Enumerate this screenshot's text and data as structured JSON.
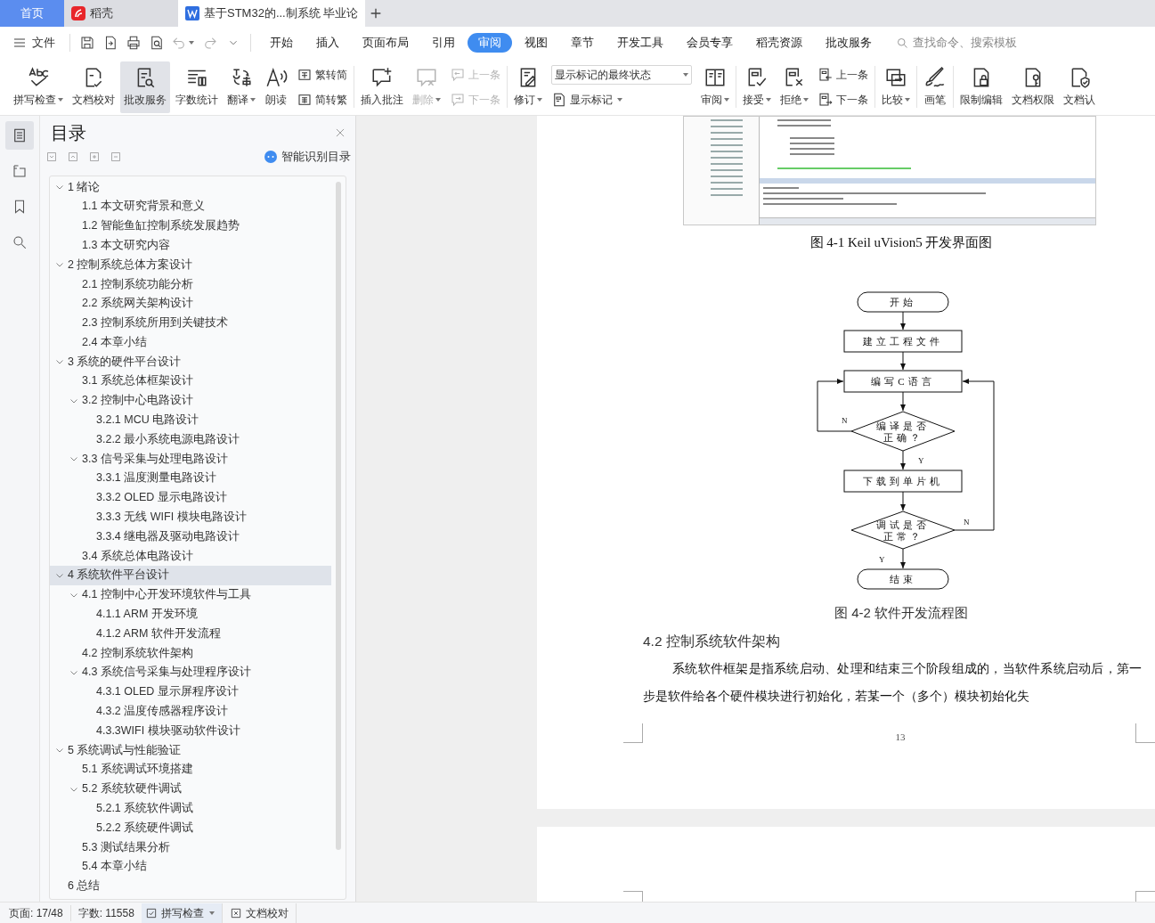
{
  "title_tabs": [
    {
      "kind": "home",
      "label": "首页",
      "selected": false
    },
    {
      "kind": "app",
      "label": "稻壳",
      "selected": false
    },
    {
      "kind": "doc",
      "label": "基于STM32的...制系统 毕业论",
      "selected": true
    }
  ],
  "menu": {
    "file": "文件",
    "tabs": [
      {
        "label": "开始",
        "selected": false
      },
      {
        "label": "插入",
        "selected": false
      },
      {
        "label": "页面布局",
        "selected": false
      },
      {
        "label": "引用",
        "selected": false
      },
      {
        "label": "审阅",
        "selected": true
      },
      {
        "label": "视图",
        "selected": false
      },
      {
        "label": "章节",
        "selected": false
      },
      {
        "label": "开发工具",
        "selected": false
      },
      {
        "label": "会员专享",
        "selected": false
      },
      {
        "label": "稻壳资源",
        "selected": false
      },
      {
        "label": "批改服务",
        "selected": false
      }
    ],
    "search": {
      "placeholder": "查找命令、搜索模板"
    }
  },
  "ribbon": {
    "groups": [
      {
        "items": [
          {
            "kind": "large",
            "label": "拼写检查",
            "caret": true,
            "disabled": false,
            "pressed": false
          },
          {
            "kind": "large",
            "label": "文档校对",
            "caret": false,
            "disabled": false,
            "pressed": false
          },
          {
            "kind": "large",
            "label": "批改服务",
            "caret": false,
            "disabled": false,
            "pressed": true
          },
          {
            "kind": "large",
            "label": "字数统计",
            "caret": false,
            "disabled": false,
            "pressed": false
          },
          {
            "kind": "large",
            "label": "翻译",
            "caret": true,
            "disabled": false,
            "pressed": false
          },
          {
            "kind": "large",
            "label": "朗读",
            "caret": false,
            "disabled": false,
            "pressed": false
          },
          {
            "kind": "stack",
            "items": [
              {
                "kind": "small",
                "label": "繁转简",
                "caret": false,
                "disabled": false
              },
              {
                "kind": "small",
                "label": "简转繁",
                "caret": false,
                "disabled": false
              }
            ]
          }
        ]
      },
      {
        "items": [
          {
            "kind": "large",
            "label": "插入批注",
            "caret": false,
            "disabled": false,
            "pressed": false
          },
          {
            "kind": "large",
            "label": "删除",
            "caret": true,
            "disabled": true,
            "pressed": false
          },
          {
            "kind": "stack",
            "items": [
              {
                "kind": "small",
                "label": "上一条",
                "caret": false,
                "disabled": true
              },
              {
                "kind": "small",
                "label": "下一条",
                "caret": false,
                "disabled": true
              }
            ]
          }
        ]
      },
      {
        "items": [
          {
            "kind": "large",
            "label": "修订",
            "caret": true,
            "disabled": false,
            "pressed": false
          },
          {
            "kind": "stack",
            "items": [
              {
                "kind": "select",
                "label": "显示标记的最终状态",
                "caret": true,
                "disabled": false
              },
              {
                "kind": "small",
                "label": "显示标记",
                "caret": true,
                "disabled": false
              }
            ]
          },
          {
            "kind": "large",
            "label": "审阅",
            "caret": true,
            "disabled": false,
            "pressed": false
          }
        ]
      },
      {
        "items": [
          {
            "kind": "large",
            "label": "接受",
            "caret": true,
            "disabled": false,
            "pressed": false
          },
          {
            "kind": "large",
            "label": "拒绝",
            "caret": true,
            "disabled": false,
            "pressed": false
          },
          {
            "kind": "stack",
            "items": [
              {
                "kind": "small",
                "label": "上一条",
                "caret": false,
                "disabled": false
              },
              {
                "kind": "small",
                "label": "下一条",
                "caret": false,
                "disabled": false
              }
            ]
          }
        ]
      },
      {
        "items": [
          {
            "kind": "large",
            "label": "比较",
            "caret": true,
            "disabled": false,
            "pressed": false
          }
        ]
      },
      {
        "items": [
          {
            "kind": "large",
            "label": "画笔",
            "caret": false,
            "disabled": false,
            "pressed": false
          }
        ]
      },
      {
        "items": [
          {
            "kind": "large",
            "label": "限制编辑",
            "caret": false,
            "disabled": false,
            "pressed": false
          },
          {
            "kind": "large",
            "label": "文档权限",
            "caret": false,
            "disabled": false,
            "pressed": false
          },
          {
            "kind": "large",
            "label": "文档认",
            "caret": false,
            "disabled": false,
            "pressed": false
          }
        ]
      }
    ]
  },
  "side_tools": [
    {
      "selected": true
    },
    {
      "selected": false
    },
    {
      "selected": false
    },
    {
      "selected": false
    }
  ],
  "toc": {
    "title": "目录",
    "smart_button": "智能识别目录",
    "items": [
      {
        "label": "1  绪论",
        "selected": false,
        "expanded": true,
        "children": [
          {
            "label": "1.1 本文研究背景和意义",
            "selected": false
          },
          {
            "label": "1.2 智能鱼缸控制系统发展趋势",
            "selected": false
          },
          {
            "label": "1.3 本文研究内容",
            "selected": false
          }
        ]
      },
      {
        "label": "2  控制系统总体方案设计",
        "selected": false,
        "expanded": true,
        "children": [
          {
            "label": "2.1 控制系统功能分析",
            "selected": false
          },
          {
            "label": "2.2 系统网关架构设计",
            "selected": false
          },
          {
            "label": "2.3 控制系统所用到关键技术",
            "selected": false
          },
          {
            "label": "2.4 本章小结",
            "selected": false
          }
        ]
      },
      {
        "label": "3  系统的硬件平台设计",
        "selected": false,
        "expanded": true,
        "children": [
          {
            "label": "3.1 系统总体框架设计",
            "selected": false
          },
          {
            "label": "3.2 控制中心电路设计",
            "selected": false,
            "expanded": true,
            "children": [
              {
                "label": "3.2.1 MCU 电路设计",
                "selected": false
              },
              {
                "label": "3.2.2 最小系统电源电路设计",
                "selected": false
              }
            ]
          },
          {
            "label": "3.3 信号采集与处理电路设计",
            "selected": false,
            "expanded": true,
            "children": [
              {
                "label": "3.3.1 温度测量电路设计",
                "selected": false
              },
              {
                "label": "3.3.2 OLED 显示电路设计",
                "selected": false
              },
              {
                "label": "3.3.3 无线 WIFI 模块电路设计",
                "selected": false
              },
              {
                "label": "3.3.4 继电器及驱动电路设计",
                "selected": false
              }
            ]
          },
          {
            "label": "3.4 系统总体电路设计",
            "selected": false
          }
        ]
      },
      {
        "label": "4  系统软件平台设计",
        "selected": true,
        "expanded": true,
        "children": [
          {
            "label": "4.1 控制中心开发环境软件与工具",
            "selected": false,
            "expanded": true,
            "children": [
              {
                "label": "4.1.1 ARM 开发环境",
                "selected": false
              },
              {
                "label": "4.1.2 ARM 软件开发流程",
                "selected": false
              }
            ]
          },
          {
            "label": "4.2 控制系统软件架构",
            "selected": false
          },
          {
            "label": "4.3 系统信号采集与处理程序设计",
            "selected": false,
            "expanded": true,
            "children": [
              {
                "label": "4.3.1 OLED 显示屏程序设计",
                "selected": false
              },
              {
                "label": "4.3.2 温度传感器程序设计",
                "selected": false
              },
              {
                "label": "4.3.3WIFI 模块驱动软件设计",
                "selected": false
              }
            ]
          }
        ]
      },
      {
        "label": "5  系统调试与性能验证",
        "selected": false,
        "expanded": true,
        "children": [
          {
            "label": "5.1 系统调试环境搭建",
            "selected": false
          },
          {
            "label": "5.2 系统软硬件调试",
            "selected": false,
            "expanded": true,
            "children": [
              {
                "label": "5.2.1 系统软件调试",
                "selected": false
              },
              {
                "label": "5.2.2 系统硬件调试",
                "selected": false
              }
            ]
          },
          {
            "label": "5.3 测试结果分析",
            "selected": false
          },
          {
            "label": "5.4 本章小结",
            "selected": false
          }
        ]
      },
      {
        "label": "6  总结",
        "selected": false
      }
    ]
  },
  "document": {
    "figure1_caption": "图 4-1 Keil uVision5 开发界面图",
    "flowchart": {
      "nodes": [
        {
          "kind": "terminal",
          "lines": [
            "开始"
          ]
        },
        {
          "kind": "process",
          "lines": [
            "建立工程文件"
          ]
        },
        {
          "kind": "process",
          "lines": [
            "编写C语言"
          ]
        },
        {
          "kind": "decision",
          "lines": [
            "编译是否",
            "正确？"
          ],
          "no_label": "N",
          "yes_label": "Y"
        },
        {
          "kind": "process",
          "lines": [
            "下载到单片机"
          ]
        },
        {
          "kind": "decision",
          "lines": [
            "调试是否",
            "正常？"
          ],
          "no_label": "N",
          "yes_label": "Y"
        },
        {
          "kind": "terminal",
          "lines": [
            "结束"
          ]
        }
      ]
    },
    "figure2_caption": "图 4-2 软件开发流程图",
    "heading": "4.2 控制系统软件架构",
    "paragraph": "系统软件框架是指系统启动、处理和结束三个阶段组成的，当软件系统启动后，第一步是软件给各个硬件模块进行初始化，若某一个（多个）模块初始化失",
    "page_number": "13"
  },
  "status_bar": {
    "page": "页面: 17/48",
    "words": "字数: 11558",
    "spell_check": "拼写检查",
    "proofread": "文档校对"
  }
}
